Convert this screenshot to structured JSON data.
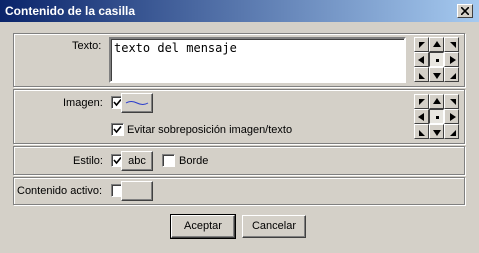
{
  "window": {
    "title": "Contenido de la casilla"
  },
  "texto": {
    "label": "Texto:",
    "value": "texto del mensaje"
  },
  "imagen": {
    "label": "Imagen:",
    "checked": true,
    "evitar_label": "Evitar sobreposición imagen/texto",
    "evitar_checked": true
  },
  "estilo": {
    "label": "Estilo:",
    "checked": true,
    "button_label": "abc",
    "borde_label": "Borde",
    "borde_checked": false
  },
  "contenido": {
    "label": "Contenido activo:",
    "checked": false
  },
  "buttons": {
    "ok": "Aceptar",
    "cancel": "Cancelar"
  },
  "icons": {
    "align_arrows": [
      "nw",
      "n",
      "ne",
      "w",
      "center",
      "e",
      "sw",
      "s",
      "se"
    ]
  }
}
